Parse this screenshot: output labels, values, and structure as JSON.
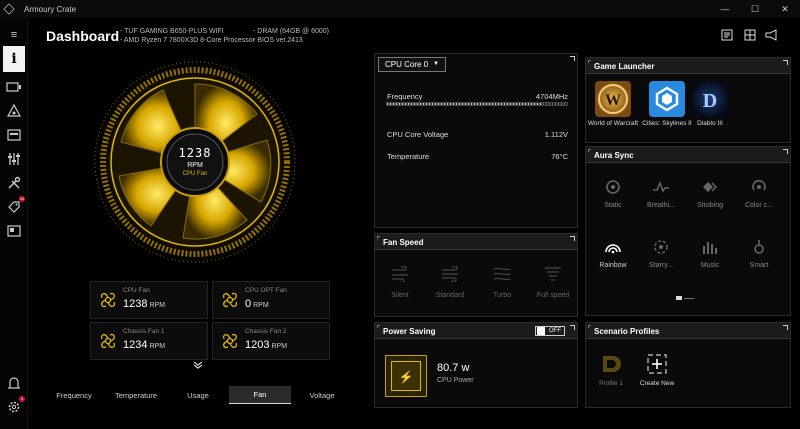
{
  "window": {
    "title": "Armoury Crate",
    "controls": [
      "—",
      "☐",
      "✕"
    ]
  },
  "sidebar": {
    "icons": [
      "menu-icon",
      "info-icon",
      "devices-icon",
      "aura-icon",
      "gamevisual-icon",
      "equalizer-icon",
      "tools-icon",
      "deals-icon",
      "news-icon",
      "account-icon",
      "settings-icon"
    ]
  },
  "header": {
    "title": "Dashboard",
    "specs_left": [
      "TUF GAMING B650-PLUS WIFI",
      "AMD Ryzen 7 7800X3D 8-Core Processor"
    ],
    "specs_right": [
      "DRAM (64GB @ 6000)",
      "BIOS ver.2413"
    ]
  },
  "big_fan": {
    "rpm": "1238",
    "unit": "RPM",
    "name": "CPU Fan"
  },
  "fans": [
    {
      "name": "CPU Fan",
      "value": "1238",
      "unit": "RPM"
    },
    {
      "name": "CPU OPT Fan",
      "value": "0",
      "unit": "RPM"
    },
    {
      "name": "Chassis Fan 1",
      "value": "1234",
      "unit": "RPM"
    },
    {
      "name": "Chassis Fan 2",
      "value": "1203",
      "unit": "RPM"
    }
  ],
  "tabs": [
    "Frequency",
    "Temperature",
    "Usage",
    "Fan",
    "Voltage"
  ],
  "active_tab": "Fan",
  "cpu_panel": {
    "selected": "CPU Core 0",
    "frequency_label": "Frequency",
    "frequency_value": "4704MHz",
    "frequency_fraction": 0.86,
    "voltage_label": "CPU Core Voltage",
    "voltage_value": "1.112V",
    "temp_label": "Temperature",
    "temp_value": "76°C"
  },
  "fan_speed": {
    "title": "Fan Speed",
    "modes": [
      "Silent",
      "Standard",
      "Turbo",
      "Full speed"
    ]
  },
  "power_saving": {
    "title": "Power Saving",
    "toggle": "OFF",
    "value": "80.7 w",
    "label": "CPU Power"
  },
  "game_launcher": {
    "title": "Game Launcher",
    "games": [
      "World of Warcraft",
      "Cities: Skylines II",
      "Diablo III"
    ]
  },
  "aura_sync": {
    "title": "Aura Sync",
    "effects": [
      "Static",
      "Breathi...",
      "Strobing",
      "Color c...",
      "Rainbow",
      "Starry...",
      "Music",
      "Smart"
    ],
    "active": "Rainbow"
  },
  "scenario": {
    "title": "Scenario Profiles",
    "items": [
      "Profile 1",
      "Create New"
    ]
  },
  "colors": {
    "accent": "#f2c400",
    "panel": "#0a0a0a",
    "header": "#1c1c1c"
  }
}
